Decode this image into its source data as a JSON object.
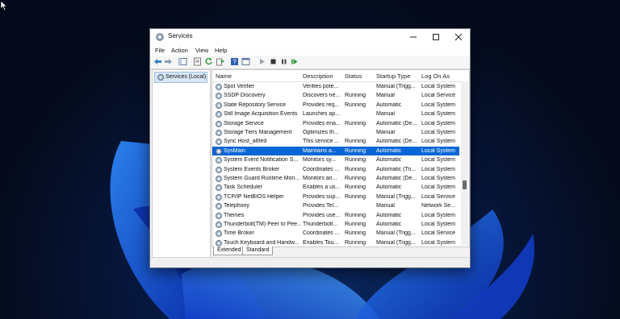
{
  "window": {
    "title": "Services"
  },
  "menu": [
    "File",
    "Action",
    "View",
    "Help"
  ],
  "toolbar": {
    "icons": [
      "back-icon",
      "forward-icon",
      "show-tree-icon",
      "properties-icon",
      "refresh-icon",
      "export-icon",
      "help-icon",
      "console-icon",
      "start-icon",
      "stop-icon",
      "pause-icon",
      "restart-icon"
    ]
  },
  "tree": {
    "item": "Services (Local)"
  },
  "columns": {
    "name": "Name",
    "description": "Description",
    "status": "Status",
    "startup": "Startup Type",
    "logon": "Log On As"
  },
  "rows": [
    {
      "name": "Spot Verifier",
      "description": "Verifies pote...",
      "status": "",
      "startup": "Manual (Trigg...",
      "logon": "Local System"
    },
    {
      "name": "SSDP Discovery",
      "description": "Discovers ne...",
      "status": "Running",
      "startup": "Manual",
      "logon": "Local Service"
    },
    {
      "name": "State Repository Service",
      "description": "Provides req...",
      "status": "Running",
      "startup": "Automatic",
      "logon": "Local System"
    },
    {
      "name": "Still Image Acquisition Events",
      "description": "Launches ap...",
      "status": "",
      "startup": "Manual",
      "logon": "Local System"
    },
    {
      "name": "Storage Service",
      "description": "Provides ena...",
      "status": "Running",
      "startup": "Automatic (De...",
      "logon": "Local System"
    },
    {
      "name": "Storage Tiers Management",
      "description": "Optimizes th...",
      "status": "",
      "startup": "Manual",
      "logon": "Local System"
    },
    {
      "name": "Sync Host_a6fed",
      "description": "This service ...",
      "status": "Running",
      "startup": "Automatic (De...",
      "logon": "Local System"
    },
    {
      "name": "SysMain",
      "description": "Maintains a...",
      "status": "Running",
      "startup": "Automatic",
      "logon": "Local System"
    },
    {
      "name": "System Event Notification S...",
      "description": "Monitors sy...",
      "status": "Running",
      "startup": "Automatic",
      "logon": "Local System"
    },
    {
      "name": "System Events Broker",
      "description": "Coordinates ...",
      "status": "Running",
      "startup": "Automatic (Tri...",
      "logon": "Local System"
    },
    {
      "name": "System Guard Runtime Mon...",
      "description": "Monitors an...",
      "status": "Running",
      "startup": "Automatic (De...",
      "logon": "Local System"
    },
    {
      "name": "Task Scheduler",
      "description": "Enables a us...",
      "status": "Running",
      "startup": "Automatic",
      "logon": "Local System"
    },
    {
      "name": "TCP/IP NetBIOS Helper",
      "description": "Provides sup...",
      "status": "Running",
      "startup": "Manual (Trigg...",
      "logon": "Local Service"
    },
    {
      "name": "Telephony",
      "description": "Provides Tel...",
      "status": "",
      "startup": "Manual",
      "logon": "Network Se..."
    },
    {
      "name": "Themes",
      "description": "Provides use...",
      "status": "Running",
      "startup": "Automatic",
      "logon": "Local System"
    },
    {
      "name": "Thunderbolt(TM) Peer to Pee...",
      "description": "Thunderbolt...",
      "status": "Running",
      "startup": "Automatic",
      "logon": "Local System"
    },
    {
      "name": "Time Broker",
      "description": "Coordinates ...",
      "status": "Running",
      "startup": "Manual (Trigg...",
      "logon": "Local Service"
    },
    {
      "name": "Touch Keyboard and Handw...",
      "description": "Enables Tou...",
      "status": "Running",
      "startup": "Manual (Trigg...",
      "logon": "Local System"
    }
  ],
  "selected_row": "SysMain",
  "tabs": [
    "Extended",
    "Standard"
  ],
  "colors": {
    "selection": "#0a66d6",
    "desktop": "#050d1f",
    "bloom": "#1f6bff"
  }
}
